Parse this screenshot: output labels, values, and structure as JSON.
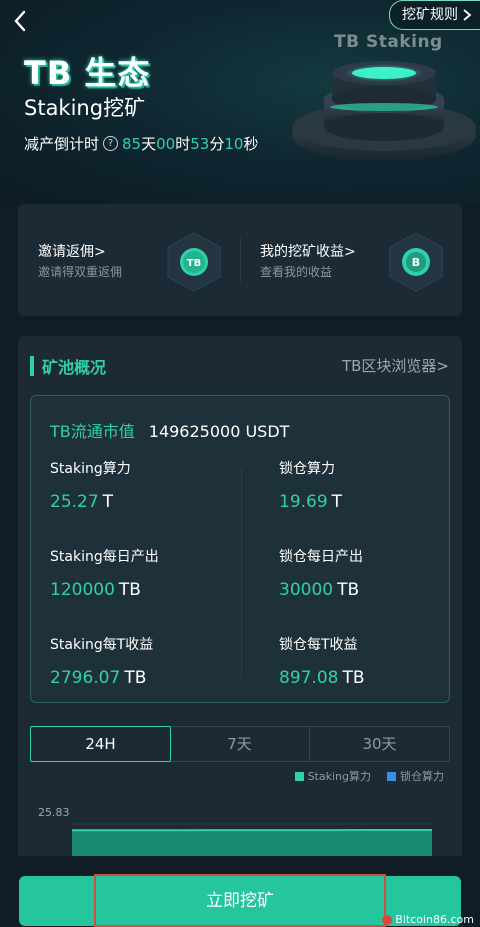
{
  "header": {
    "back_icon": "chevron-left-icon",
    "rules_label": "挖矿规则",
    "title": "TB 生态",
    "subtitle": "Staking挖矿",
    "countdown": {
      "label": "减产倒计时",
      "days": "85",
      "days_unit": "天",
      "hours": "00",
      "hours_unit": "时",
      "minutes": "53",
      "minutes_unit": "分",
      "seconds": "10",
      "seconds_unit": "秒"
    },
    "graphic_label": "TB Staking"
  },
  "invite": {
    "left_title": "邀请返佣>",
    "left_sub": "邀请得双重返佣",
    "left_icon_text": "TB",
    "right_title": "我的挖矿收益>",
    "right_sub": "查看我的收益",
    "right_icon_text": "B"
  },
  "pool": {
    "title": "矿池概况",
    "explorer_link": "TB区块浏览器>",
    "market_label": "TB流通市值",
    "market_value": "149625000 USDT",
    "stats": [
      {
        "label": "Staking算力",
        "value": "25.27",
        "unit": "T"
      },
      {
        "label": "锁仓算力",
        "value": "19.69",
        "unit": "T"
      },
      {
        "label": "Staking每日产出",
        "value": "120000",
        "unit": "TB"
      },
      {
        "label": "锁仓每日产出",
        "value": "30000",
        "unit": "TB"
      },
      {
        "label": "Staking每T收益",
        "value": "2796.07",
        "unit": "TB"
      },
      {
        "label": "锁仓每T收益",
        "value": "897.08",
        "unit": "TB"
      }
    ]
  },
  "tabs": [
    "24H",
    "7天",
    "30天"
  ],
  "active_tab": "24H",
  "legend": [
    {
      "name": "Staking算力",
      "color": "#2fd1a8"
    },
    {
      "name": "锁仓算力",
      "color": "#3a8fe0"
    }
  ],
  "chart_data": {
    "type": "area",
    "series": [
      {
        "name": "Staking算力",
        "values": [
          25.8,
          25.81,
          25.81,
          25.82,
          25.82,
          25.82,
          25.83,
          25.83
        ]
      }
    ],
    "y_tick_top": "25.83"
  },
  "action_button": "立即挖矿",
  "watermark": "Bitcoin86.com",
  "colors": {
    "accent": "#2fd1a8",
    "button": "#25c59e",
    "background": "#101d26",
    "card": "#1b2a35"
  }
}
